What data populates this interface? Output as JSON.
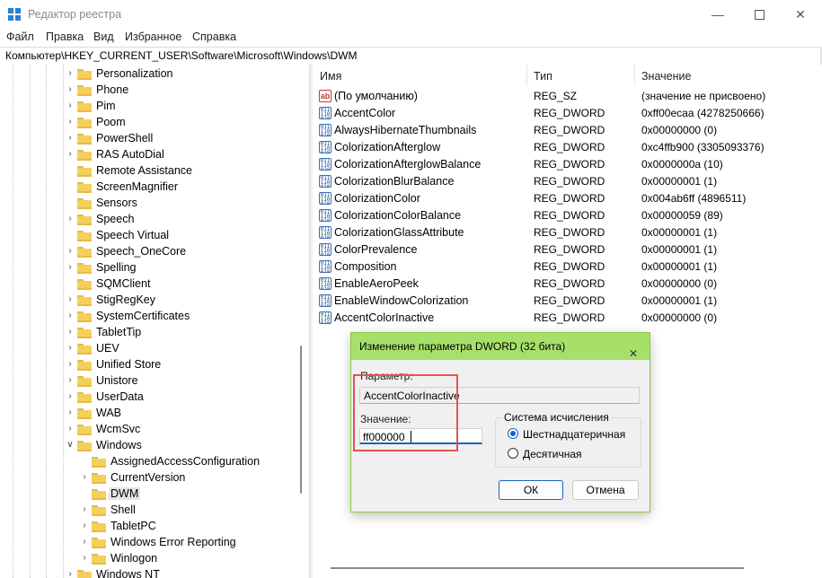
{
  "window": {
    "title": "Редактор реестра",
    "minimize_icon": "minimize-icon",
    "maximize_icon": "maximize-icon",
    "close_icon": "close-icon"
  },
  "menu": {
    "items": [
      "Файл",
      "Правка",
      "Вид",
      "Избранное",
      "Справка"
    ]
  },
  "address": {
    "path": "Компьютер\\HKEY_CURRENT_USER\\Software\\Microsoft\\Windows\\DWM"
  },
  "tree": {
    "items": [
      {
        "label": "Personalization",
        "expander": "collapsed",
        "level": 1
      },
      {
        "label": "Phone",
        "expander": "collapsed",
        "level": 1
      },
      {
        "label": "Pim",
        "expander": "collapsed",
        "level": 1
      },
      {
        "label": "Poom",
        "expander": "collapsed",
        "level": 1
      },
      {
        "label": "PowerShell",
        "expander": "collapsed",
        "level": 1
      },
      {
        "label": "RAS AutoDial",
        "expander": "collapsed",
        "level": 1
      },
      {
        "label": "Remote Assistance",
        "expander": "none",
        "level": 1
      },
      {
        "label": "ScreenMagnifier",
        "expander": "none",
        "level": 1
      },
      {
        "label": "Sensors",
        "expander": "none",
        "level": 1
      },
      {
        "label": "Speech",
        "expander": "collapsed",
        "level": 1
      },
      {
        "label": "Speech Virtual",
        "expander": "none",
        "level": 1
      },
      {
        "label": "Speech_OneCore",
        "expander": "collapsed",
        "level": 1
      },
      {
        "label": "Spelling",
        "expander": "collapsed",
        "level": 1
      },
      {
        "label": "SQMClient",
        "expander": "none",
        "level": 1
      },
      {
        "label": "StigRegKey",
        "expander": "collapsed",
        "level": 1
      },
      {
        "label": "SystemCertificates",
        "expander": "collapsed",
        "level": 1
      },
      {
        "label": "TabletTip",
        "expander": "collapsed",
        "level": 1
      },
      {
        "label": "UEV",
        "expander": "collapsed",
        "level": 1
      },
      {
        "label": "Unified Store",
        "expander": "collapsed",
        "level": 1
      },
      {
        "label": "Unistore",
        "expander": "collapsed",
        "level": 1
      },
      {
        "label": "UserData",
        "expander": "collapsed",
        "level": 1
      },
      {
        "label": "WAB",
        "expander": "collapsed",
        "level": 1
      },
      {
        "label": "WcmSvc",
        "expander": "collapsed",
        "level": 1
      },
      {
        "label": "Windows",
        "expander": "expanded",
        "level": 1
      },
      {
        "label": "AssignedAccessConfiguration",
        "expander": "none",
        "level": 2
      },
      {
        "label": "CurrentVersion",
        "expander": "collapsed",
        "level": 2
      },
      {
        "label": "DWM",
        "expander": "none",
        "level": 2,
        "selected": true
      },
      {
        "label": "Shell",
        "expander": "collapsed",
        "level": 2
      },
      {
        "label": "TabletPC",
        "expander": "collapsed",
        "level": 2
      },
      {
        "label": "Windows Error Reporting",
        "expander": "collapsed",
        "level": 2
      },
      {
        "label": "Winlogon",
        "expander": "collapsed",
        "level": 2
      },
      {
        "label": "Windows NT",
        "expander": "collapsed",
        "level": 1
      }
    ]
  },
  "list": {
    "columns": {
      "name": "Имя",
      "type": "Тип",
      "value": "Значение"
    },
    "rows": [
      {
        "name": "(По умолчанию)",
        "type": "REG_SZ",
        "value": "(значение не присвоено)",
        "icon": "string-value-icon"
      },
      {
        "name": "AccentColor",
        "type": "REG_DWORD",
        "value": "0xff00ecaa (4278250666)",
        "icon": "binary-value-icon"
      },
      {
        "name": "AlwaysHibernateThumbnails",
        "type": "REG_DWORD",
        "value": "0x00000000 (0)",
        "icon": "binary-value-icon"
      },
      {
        "name": "ColorizationAfterglow",
        "type": "REG_DWORD",
        "value": "0xc4ffb900 (3305093376)",
        "icon": "binary-value-icon"
      },
      {
        "name": "ColorizationAfterglowBalance",
        "type": "REG_DWORD",
        "value": "0x0000000a (10)",
        "icon": "binary-value-icon"
      },
      {
        "name": "ColorizationBlurBalance",
        "type": "REG_DWORD",
        "value": "0x00000001 (1)",
        "icon": "binary-value-icon"
      },
      {
        "name": "ColorizationColor",
        "type": "REG_DWORD",
        "value": "0x004ab6ff (4896511)",
        "icon": "binary-value-icon"
      },
      {
        "name": "ColorizationColorBalance",
        "type": "REG_DWORD",
        "value": "0x00000059 (89)",
        "icon": "binary-value-icon"
      },
      {
        "name": "ColorizationGlassAttribute",
        "type": "REG_DWORD",
        "value": "0x00000001 (1)",
        "icon": "binary-value-icon"
      },
      {
        "name": "ColorPrevalence",
        "type": "REG_DWORD",
        "value": "0x00000001 (1)",
        "icon": "binary-value-icon"
      },
      {
        "name": "Composition",
        "type": "REG_DWORD",
        "value": "0x00000001 (1)",
        "icon": "binary-value-icon"
      },
      {
        "name": "EnableAeroPeek",
        "type": "REG_DWORD",
        "value": "0x00000000 (0)",
        "icon": "binary-value-icon"
      },
      {
        "name": "EnableWindowColorization",
        "type": "REG_DWORD",
        "value": "0x00000001 (1)",
        "icon": "binary-value-icon"
      },
      {
        "name": "AccentColorInactive",
        "type": "REG_DWORD",
        "value": "0x00000000 (0)",
        "icon": "binary-value-icon"
      }
    ]
  },
  "dialog": {
    "title": "Изменение параметра DWORD (32 бита)",
    "param_label": "Параметр:",
    "param_value": "AccentColorInactive",
    "value_label": "Значение:",
    "value_data": "ff000000",
    "base_group_title": "Система исчисления",
    "radio_hex": "Шестнадцатеричная",
    "radio_dec": "Десятичная",
    "selected_base": "hex",
    "ok_label": "ОК",
    "cancel_label": "Отмена"
  },
  "colors": {
    "dialog_title_bg": "#a6e06a",
    "highlight_box": "#e5534b",
    "accent": "#1a62c9",
    "folder": "#f5cf5c"
  }
}
